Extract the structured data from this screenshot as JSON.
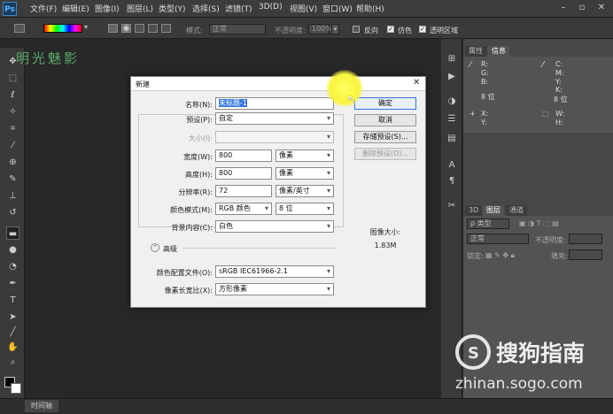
{
  "app": {
    "logo": "Ps"
  },
  "menubar": [
    "文件(F)",
    "编辑(E)",
    "图像(I)",
    "图层(L)",
    "类型(Y)",
    "选择(S)",
    "滤镜(T)",
    "3D(D)",
    "视图(V)",
    "窗口(W)",
    "帮助(H)"
  ],
  "options": {
    "mode_label": "模式:",
    "mode_value": "正常",
    "opacity_label": "不透明度:",
    "opacity_value": "100%",
    "reverse_label": "反向",
    "dither_label": "仿色",
    "transparency_label": "透明区域"
  },
  "watermark_text": "明光魅影",
  "statusbar": {
    "timeline_tab": "时间轴"
  },
  "right_panel": {
    "tabs": [
      "属性",
      "信息"
    ],
    "info": {
      "r": "R:",
      "g": "G:",
      "b": "B:",
      "c": "C:",
      "m": "M:",
      "y": "Y:",
      "k": "K:",
      "bits_left": "8 位",
      "bits_right": "8 位",
      "x": "X:",
      "y2": "Y:",
      "w": "W:",
      "h": "H:"
    },
    "layers_tabs": [
      "3D",
      "图层",
      "通道"
    ],
    "layers": {
      "kind_label": "ρ 类型",
      "blend_value": "正常",
      "opacity_label": "不透明度:",
      "lock_label": "锁定:",
      "fill_label": "填充:"
    }
  },
  "dialog": {
    "title": "新建",
    "name_label": "名称(N):",
    "name_value": "未标题-1",
    "preset_label": "预设(P):",
    "preset_value": "自定",
    "size_label": "大小(I):",
    "width_label": "宽度(W):",
    "width_value": "800",
    "width_unit": "像素",
    "height_label": "高度(H):",
    "height_value": "800",
    "height_unit": "像素",
    "resolution_label": "分辨率(R):",
    "resolution_value": "72",
    "resolution_unit": "像素/英寸",
    "color_mode_label": "颜色模式(M):",
    "color_mode_value": "RGB 颜色",
    "bit_depth_value": "8 位",
    "background_label": "背景内容(C):",
    "background_value": "白色",
    "advanced_label": "高级",
    "profile_label": "颜色配置文件(O):",
    "profile_value": "sRGB IEC61966-2.1",
    "aspect_label": "像素长宽比(X):",
    "aspect_value": "方形像素",
    "ok_label": "确定",
    "cancel_label": "取消",
    "save_preset_label": "存储预设(S)...",
    "delete_preset_label": "删除预设(D)...",
    "image_size_label": "图像大小:",
    "image_size_value": "1.83M"
  },
  "sogou": {
    "brand": "搜狗指南",
    "url": "zhinan.sogo.com"
  }
}
